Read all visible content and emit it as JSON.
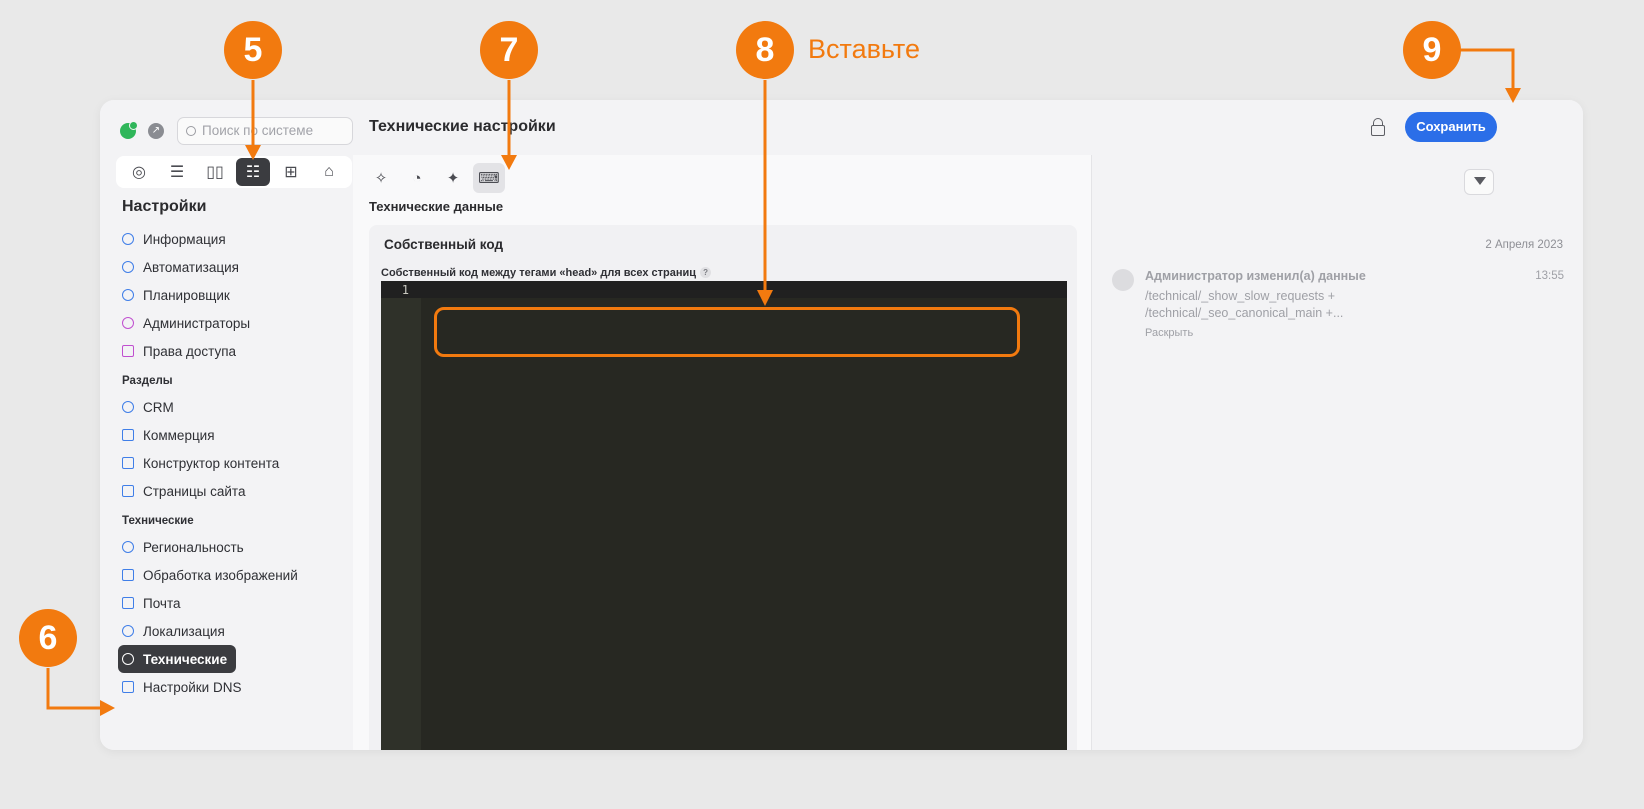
{
  "sidebar": {
    "search_placeholder": "Поиск по системе",
    "title": "Настройки",
    "items_main": [
      {
        "label": "Информация",
        "icon": "info-icon"
      },
      {
        "label": "Автоматизация",
        "icon": "lightning-icon"
      },
      {
        "label": "Планировщик",
        "icon": "clock-icon"
      },
      {
        "label": "Администраторы",
        "icon": "admin-icon"
      },
      {
        "label": "Права доступа",
        "icon": "unlock-icon"
      }
    ],
    "section_razdely": "Разделы",
    "items_razdely": [
      {
        "label": "CRM",
        "icon": "crm-icon"
      },
      {
        "label": "Коммерция",
        "icon": "bag-icon"
      },
      {
        "label": "Конструктор контента",
        "icon": "copy-icon"
      },
      {
        "label": "Страницы сайта",
        "icon": "grid-icon"
      }
    ],
    "section_tech": "Технические",
    "items_tech": [
      {
        "label": "Региональность",
        "icon": "location-icon"
      },
      {
        "label": "Обработка изображений",
        "icon": "image-icon"
      },
      {
        "label": "Почта",
        "icon": "mail-icon"
      },
      {
        "label": "Локализация",
        "icon": "globe-icon"
      },
      {
        "label": "Технические",
        "icon": "gear-icon",
        "active": true
      },
      {
        "label": "Настройки DNS",
        "icon": "server-icon"
      }
    ]
  },
  "header": {
    "title": "Технические настройки",
    "save_label": "Сохранить",
    "save_color": "#2b6ee8"
  },
  "content": {
    "section_label": "Технические данные",
    "card_title": "Собственный код",
    "field_label": "Собственный код между тегами «head» для всех страниц",
    "help_glyph": "?",
    "editor": {
      "line_numbers": [
        "1"
      ]
    }
  },
  "history": {
    "date": "2 Апреля 2023",
    "entry": {
      "title": "Администратор изменил(а) данные",
      "time": "13:55",
      "line1": "/technical/_show_slow_requests +",
      "line2": "/technical/_seo_canonical_main +...",
      "expand_label": "Раскрыть"
    }
  },
  "annotations": {
    "badge_5": "5",
    "badge_6": "6",
    "badge_7": "7",
    "badge_8": "8",
    "badge_9": "9",
    "label_8": "Вставьте",
    "accent_color": "#f27a0f"
  }
}
